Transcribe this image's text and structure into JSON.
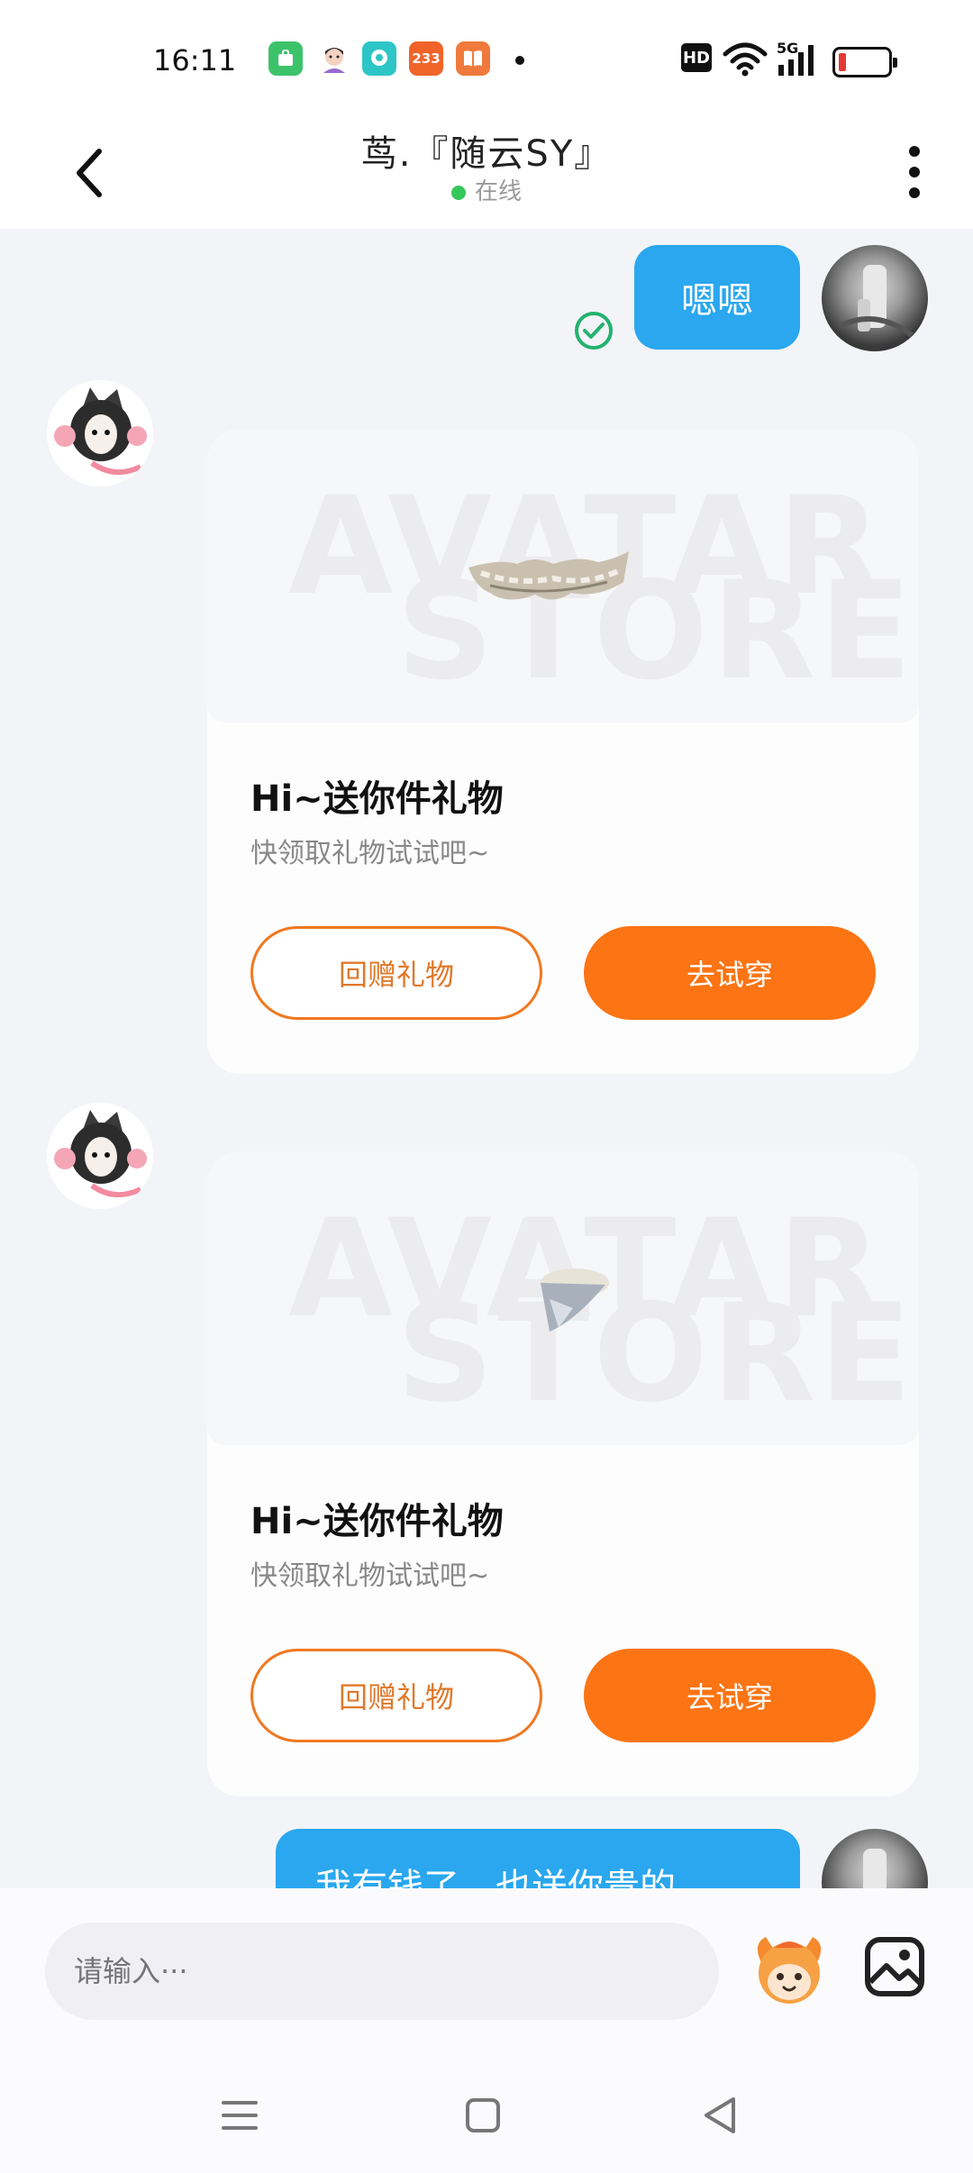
{
  "status_bar": {
    "time": "16:11",
    "notifications": [
      {
        "icon": "app-green-icon",
        "color": "#3cc36a",
        "text": ""
      },
      {
        "icon": "avatar-app-icon",
        "color": "#ffffff",
        "text": ""
      },
      {
        "icon": "chat-app-icon",
        "color": "#2ec5c7",
        "text": ""
      },
      {
        "icon": "233-app-icon",
        "color": "#f0642a",
        "text": "233"
      },
      {
        "icon": "book-app-icon",
        "color": "#f07a3c",
        "text": ""
      }
    ],
    "hd_label": "HD",
    "network_label": "5G",
    "battery_level": 0.15
  },
  "header": {
    "title": "茑.『随云SY』",
    "status": "在线"
  },
  "messages": [
    {
      "type": "outgoing",
      "text": "嗯嗯",
      "read": true
    },
    {
      "type": "gift-card",
      "title": "Hi~送你件礼物",
      "subtitle": "快领取礼物试试吧~",
      "watermark_line1": "AVATAR",
      "watermark_line2": "STORE",
      "gift_item": "teeth-ornament",
      "return_gift_label": "回赠礼物",
      "try_on_label": "去试穿"
    },
    {
      "type": "gift-card",
      "title": "Hi~送你件礼物",
      "subtitle": "快领取礼物试试吧~",
      "watermark_line1": "AVATAR",
      "watermark_line2": "STORE",
      "gift_item": "earring-ornament",
      "return_gift_label": "回赠礼物",
      "try_on_label": "去试穿"
    },
    {
      "type": "outgoing",
      "text": "我有钱了，也送你贵的"
    }
  ],
  "input": {
    "placeholder": "请输入···"
  },
  "colors": {
    "accent_orange": "#fc7413",
    "bubble_blue": "#2aa7ee",
    "online_green": "#34c759"
  }
}
